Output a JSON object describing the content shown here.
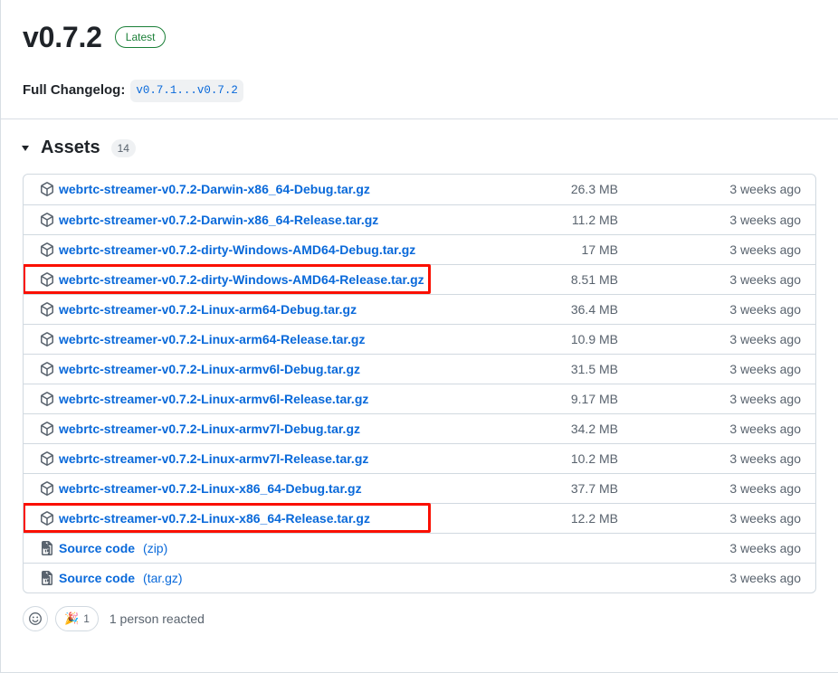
{
  "release": {
    "version": "v0.7.2",
    "latest_badge": "Latest",
    "changelog_label": "Full Changelog:",
    "changelog_link": "v0.7.1...v0.7.2"
  },
  "assets": {
    "heading": "Assets",
    "count": "14",
    "rows": [
      {
        "name": "webrtc-streamer-v0.7.2-Darwin-x86_64-Debug.tar.gz",
        "suffix": "",
        "size": "26.3 MB",
        "date": "3 weeks ago",
        "icon": "package-icon",
        "highlighted": false
      },
      {
        "name": "webrtc-streamer-v0.7.2-Darwin-x86_64-Release.tar.gz",
        "suffix": "",
        "size": "11.2 MB",
        "date": "3 weeks ago",
        "icon": "package-icon",
        "highlighted": false
      },
      {
        "name": "webrtc-streamer-v0.7.2-dirty-Windows-AMD64-Debug.tar.gz",
        "suffix": "",
        "size": "17 MB",
        "date": "3 weeks ago",
        "icon": "package-icon",
        "highlighted": false
      },
      {
        "name": "webrtc-streamer-v0.7.2-dirty-Windows-AMD64-Release.tar.gz",
        "suffix": "",
        "size": "8.51 MB",
        "date": "3 weeks ago",
        "icon": "package-icon",
        "highlighted": true
      },
      {
        "name": "webrtc-streamer-v0.7.2-Linux-arm64-Debug.tar.gz",
        "suffix": "",
        "size": "36.4 MB",
        "date": "3 weeks ago",
        "icon": "package-icon",
        "highlighted": false
      },
      {
        "name": "webrtc-streamer-v0.7.2-Linux-arm64-Release.tar.gz",
        "suffix": "",
        "size": "10.9 MB",
        "date": "3 weeks ago",
        "icon": "package-icon",
        "highlighted": false
      },
      {
        "name": "webrtc-streamer-v0.7.2-Linux-armv6l-Debug.tar.gz",
        "suffix": "",
        "size": "31.5 MB",
        "date": "3 weeks ago",
        "icon": "package-icon",
        "highlighted": false
      },
      {
        "name": "webrtc-streamer-v0.7.2-Linux-armv6l-Release.tar.gz",
        "suffix": "",
        "size": "9.17 MB",
        "date": "3 weeks ago",
        "icon": "package-icon",
        "highlighted": false
      },
      {
        "name": "webrtc-streamer-v0.7.2-Linux-armv7l-Debug.tar.gz",
        "suffix": "",
        "size": "34.2 MB",
        "date": "3 weeks ago",
        "icon": "package-icon",
        "highlighted": false
      },
      {
        "name": "webrtc-streamer-v0.7.2-Linux-armv7l-Release.tar.gz",
        "suffix": "",
        "size": "10.2 MB",
        "date": "3 weeks ago",
        "icon": "package-icon",
        "highlighted": false
      },
      {
        "name": "webrtc-streamer-v0.7.2-Linux-x86_64-Debug.tar.gz",
        "suffix": "",
        "size": "37.7 MB",
        "date": "3 weeks ago",
        "icon": "package-icon",
        "highlighted": false
      },
      {
        "name": "webrtc-streamer-v0.7.2-Linux-x86_64-Release.tar.gz",
        "suffix": "",
        "size": "12.2 MB",
        "date": "3 weeks ago",
        "icon": "package-icon",
        "highlighted": true
      },
      {
        "name": "Source code",
        "suffix": "(zip)",
        "size": "",
        "date": "3 weeks ago",
        "icon": "file-zip-icon",
        "highlighted": false
      },
      {
        "name": "Source code",
        "suffix": "(tar.gz)",
        "size": "",
        "date": "3 weeks ago",
        "icon": "file-zip-icon",
        "highlighted": false
      }
    ]
  },
  "reactions": {
    "add_label": "add-reaction",
    "emoji": "🎉",
    "count": "1",
    "summary": "1 person reacted"
  },
  "colors": {
    "link": "#0969da",
    "muted": "#59636e",
    "border": "#d1d9e0",
    "latest_green": "#1a7f37",
    "highlight_red": "#fa0f00"
  }
}
